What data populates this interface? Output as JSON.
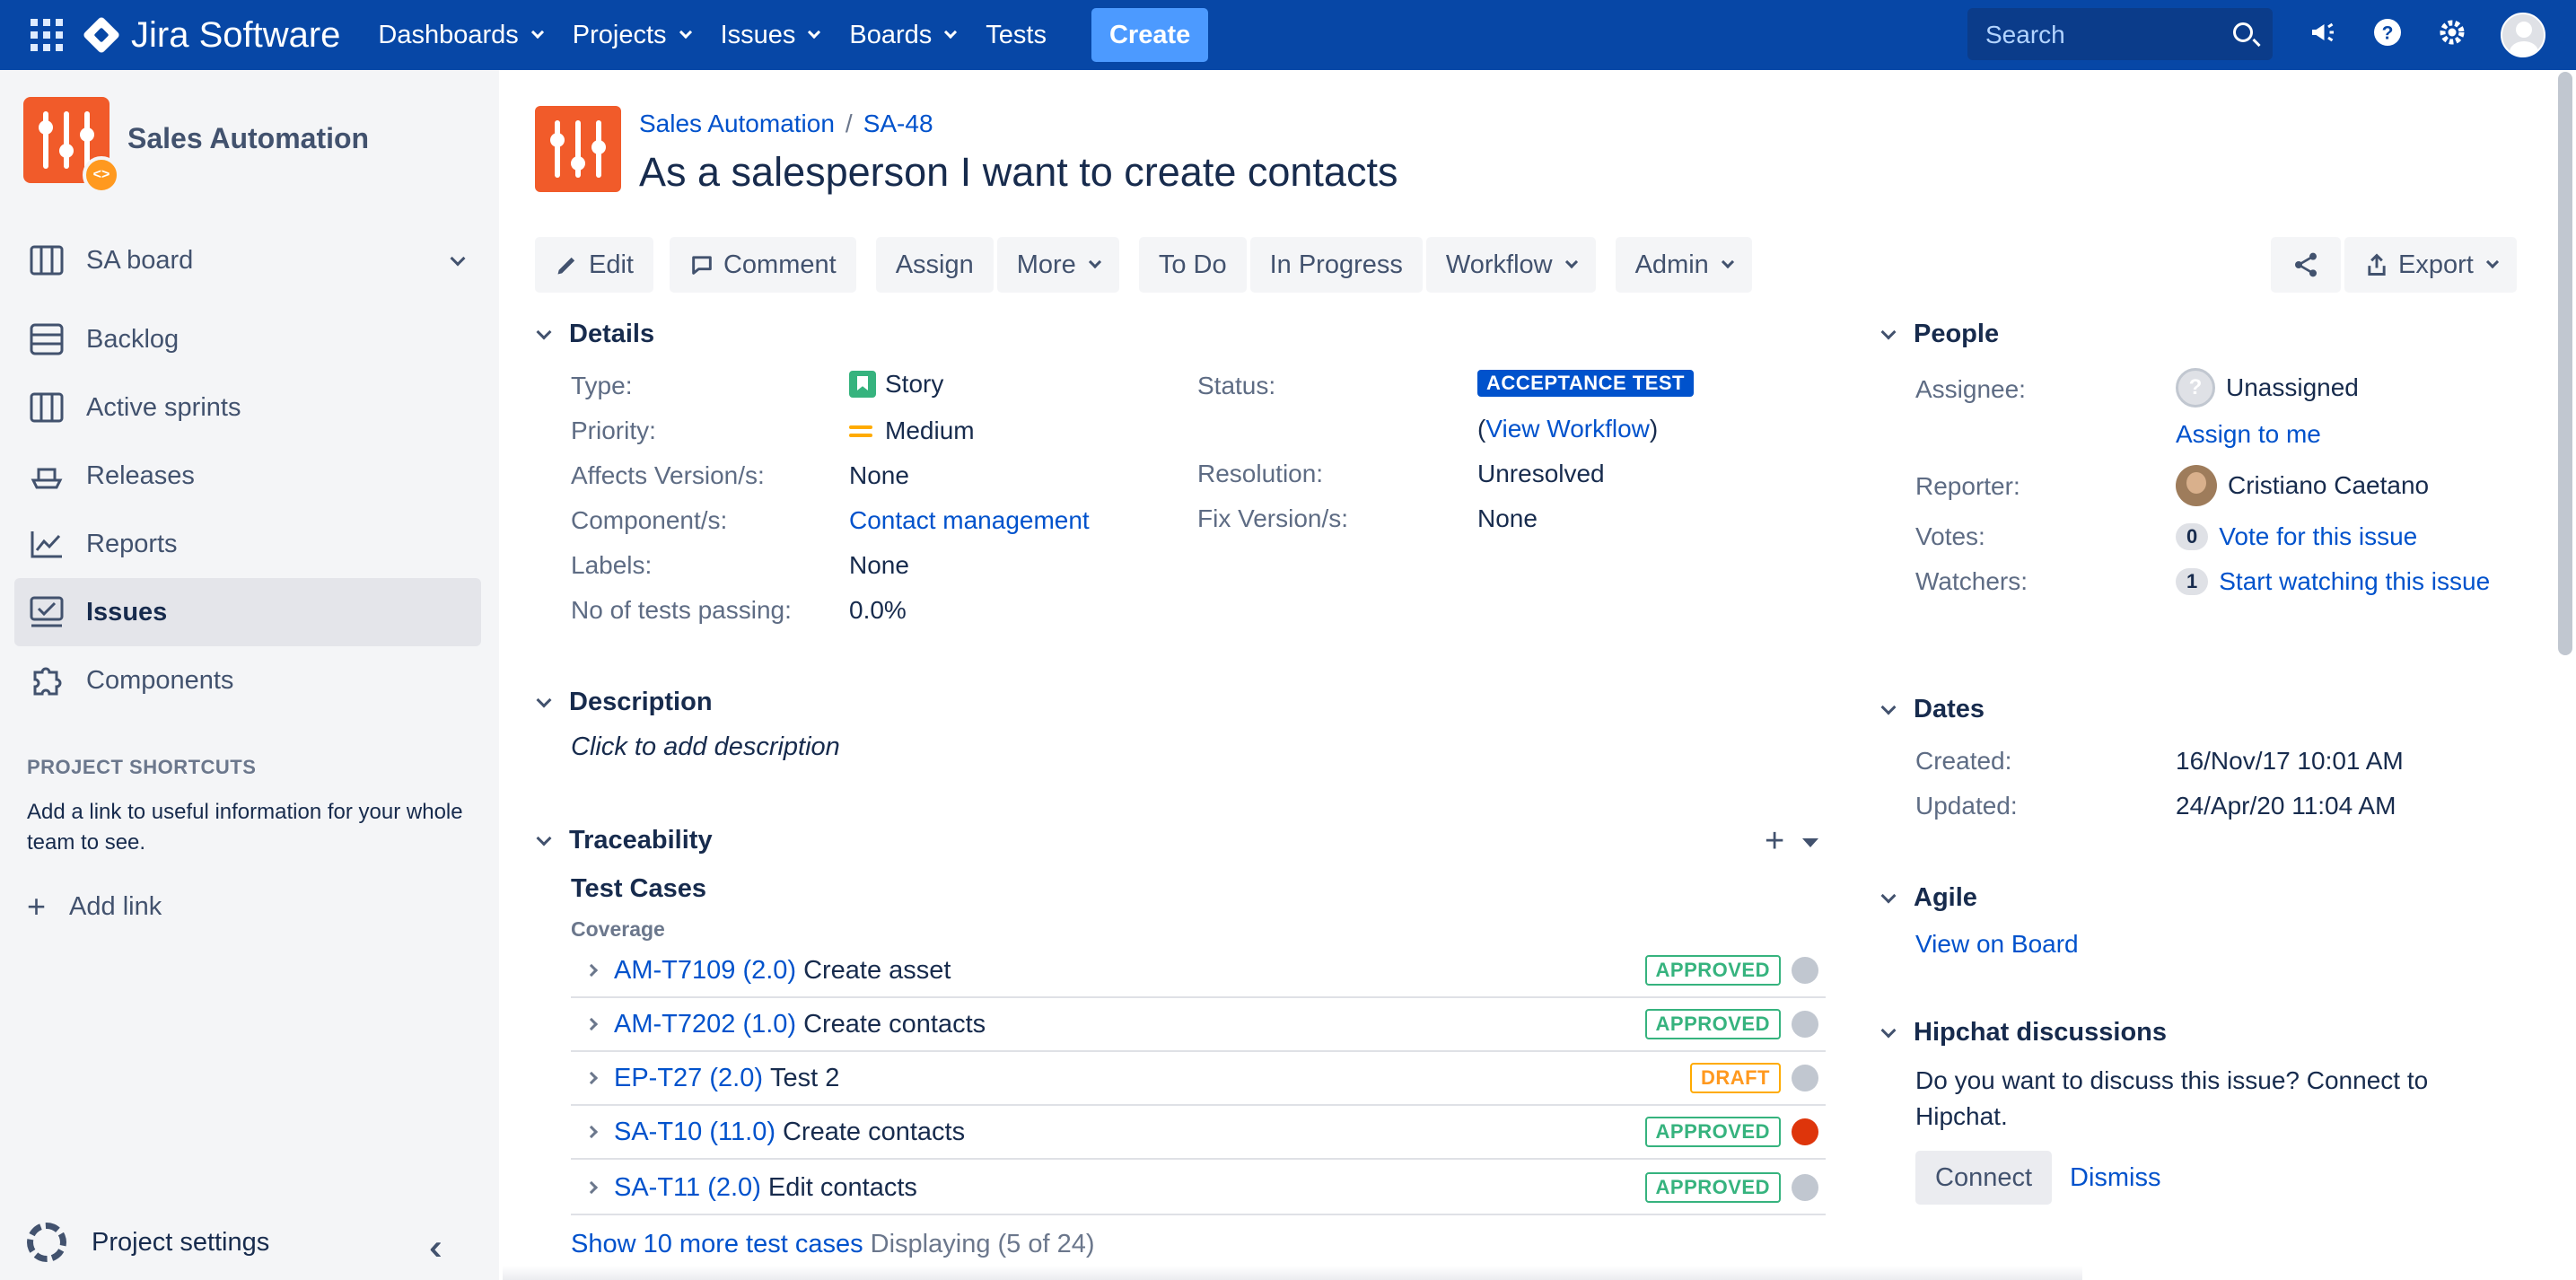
{
  "topnav": {
    "product": "Jira Software",
    "items": [
      {
        "label": "Dashboards",
        "dropdown": true
      },
      {
        "label": "Projects",
        "dropdown": true
      },
      {
        "label": "Issues",
        "dropdown": true
      },
      {
        "label": "Boards",
        "dropdown": true
      },
      {
        "label": "Tests",
        "dropdown": false
      }
    ],
    "create": "Create",
    "search_placeholder": "Search",
    "icons": [
      "megaphone-icon",
      "help-icon",
      "gear-icon",
      "user-avatar"
    ]
  },
  "sidebar": {
    "project_name": "Sales Automation",
    "board": "SA board",
    "items": [
      {
        "label": "Backlog",
        "icon": "backlog-icon"
      },
      {
        "label": "Active sprints",
        "icon": "board-icon"
      },
      {
        "label": "Releases",
        "icon": "ship-icon"
      },
      {
        "label": "Reports",
        "icon": "chart-icon"
      },
      {
        "label": "Issues",
        "icon": "issues-icon",
        "active": true
      },
      {
        "label": "Components",
        "icon": "puzzle-icon"
      }
    ],
    "shortcuts_title": "PROJECT SHORTCUTS",
    "shortcuts_desc": "Add a link to useful information for your whole team to see.",
    "add_link": "Add link",
    "settings": "Project settings"
  },
  "issue": {
    "breadcrumb": [
      "Sales Automation",
      "SA-48"
    ],
    "title": "As a salesperson I want to create contacts"
  },
  "toolbar": {
    "edit": "Edit",
    "comment": "Comment",
    "assign": "Assign",
    "more": "More",
    "todo": "To Do",
    "in_progress": "In Progress",
    "workflow": "Workflow",
    "admin": "Admin",
    "export": "Export"
  },
  "details": {
    "heading": "Details",
    "type_label": "Type:",
    "type": "Story",
    "priority_label": "Priority:",
    "priority": "Medium",
    "affects_label": "Affects Version/s:",
    "affects": "None",
    "component_label": "Component/s:",
    "component": "Contact management",
    "labels_label": "Labels:",
    "labels": "None",
    "tests_label": "No of tests passing:",
    "tests": "0.0%",
    "status_label": "Status:",
    "status": "ACCEPTANCE TEST",
    "view_workflow": "View Workflow",
    "resolution_label": "Resolution:",
    "resolution": "Unresolved",
    "fix_label": "Fix Version/s:",
    "fix": "None"
  },
  "description": {
    "heading": "Description",
    "placeholder": "Click to add description"
  },
  "traceability": {
    "heading": "Traceability",
    "subheading": "Test Cases",
    "coverage": "Coverage",
    "rows": [
      {
        "key": "AM-T7109 (2.0)",
        "name": "Create asset",
        "status": "APPROVED",
        "result": "grey"
      },
      {
        "key": "AM-T7202 (1.0)",
        "name": "Create contacts",
        "status": "APPROVED",
        "result": "grey"
      },
      {
        "key": "EP-T27 (2.0)",
        "name": "Test 2",
        "status": "DRAFT",
        "result": "grey"
      },
      {
        "key": "SA-T10 (11.0)",
        "name": "Create contacts",
        "status": "APPROVED",
        "result": "red"
      },
      {
        "key": "SA-T11 (2.0)",
        "name": "Edit contacts",
        "status": "APPROVED",
        "result": "grey"
      }
    ],
    "show_more": "Show 10 more test cases",
    "displaying": "Displaying (5 of 24)"
  },
  "people": {
    "heading": "People",
    "assignee_label": "Assignee:",
    "assignee": "Unassigned",
    "assign_to_me": "Assign to me",
    "reporter_label": "Reporter:",
    "reporter": "Cristiano Caetano",
    "votes_label": "Votes:",
    "votes_count": "0",
    "vote_link": "Vote for this issue",
    "watchers_label": "Watchers:",
    "watchers_count": "1",
    "watch_link": "Start watching this issue"
  },
  "dates": {
    "heading": "Dates",
    "created_label": "Created:",
    "created": "16/Nov/17 10:01 AM",
    "updated_label": "Updated:",
    "updated": "24/Apr/20 11:04 AM"
  },
  "agile": {
    "heading": "Agile",
    "view_on_board": "View on Board"
  },
  "hipchat": {
    "heading": "Hipchat discussions",
    "text": "Do you want to discuss this issue? Connect to Hipchat.",
    "connect": "Connect",
    "dismiss": "Dismiss"
  },
  "colors": {
    "nav": "#0747A6",
    "accent": "#0052CC",
    "create": "#4C9AFF",
    "project_avatar": "#F15B2A",
    "approved": "#36B37E",
    "draft": "#FFAB00",
    "fail": "#DE350B"
  }
}
